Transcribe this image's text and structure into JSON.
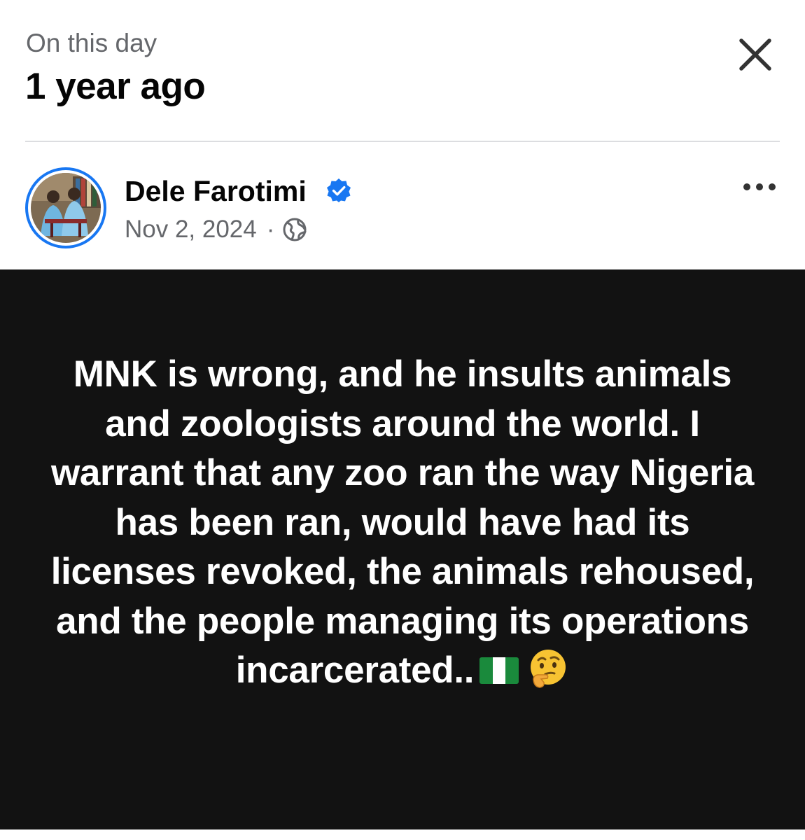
{
  "header": {
    "subtitle": "On this day",
    "title": "1 year ago",
    "close_icon": "close-icon"
  },
  "post": {
    "author": "Dele Farotimi",
    "verified_icon": "verified-badge-icon",
    "date": "Nov 2, 2024",
    "separator": "·",
    "audience_icon": "globe-icon",
    "more_icon": "more-options-icon",
    "text": "MNK is wrong, and he insults animals and zoologists around the world. I warrant that any zoo ran the way Nigeria has been ran, would have had its licenses revoked, the animals rehoused, and the people managing its operations incarcerated..",
    "trailing_icons": [
      "nigeria-flag-icon",
      "thinking-face-icon"
    ]
  },
  "colors": {
    "accent": "#1877f2",
    "secondary_text": "#65676b",
    "post_background": "#121212",
    "post_text": "#ffffff"
  }
}
